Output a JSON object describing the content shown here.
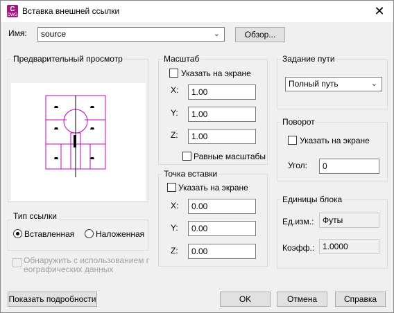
{
  "window": {
    "title": "Вставка внешней ссылки",
    "app_icon_letter": "C",
    "app_icon_sub": "DWG",
    "close_glyph": "✕"
  },
  "name_row": {
    "label": "Имя:",
    "value": "source",
    "browse_label": "Обзор..."
  },
  "preview": {
    "title": "Предварительный просмотр"
  },
  "scale": {
    "title": "Масштаб",
    "specify_on_screen": "Указать на экране",
    "x_label": "X:",
    "x_value": "1.00",
    "y_label": "Y:",
    "y_value": "1.00",
    "z_label": "Z:",
    "z_value": "1.00",
    "uniform_label": "Равные масштабы"
  },
  "path_type": {
    "title": "Задание пути",
    "value": "Полный путь"
  },
  "rotation": {
    "title": "Поворот",
    "specify_on_screen": "Указать на экране",
    "angle_label": "Угол:",
    "angle_value": "0"
  },
  "insertion": {
    "title": "Точка вставки",
    "specify_on_screen": "Указать на экране",
    "x_label": "X:",
    "x_value": "0.00",
    "y_label": "Y:",
    "y_value": "0.00",
    "z_label": "Z:",
    "z_value": "0.00"
  },
  "block_units": {
    "title": "Единицы блока",
    "unit_label": "Ед.изм.:",
    "unit_value": "Футы",
    "factor_label": "Коэфф.:",
    "factor_value": "1.0000"
  },
  "reference_type": {
    "title": "Тип ссылки",
    "attach_label": "Вставленная",
    "overlay_label": "Наложенная"
  },
  "geo": {
    "line1": "Обнаружить с использованием г",
    "line2": "еографических данных"
  },
  "buttons": {
    "details": "Показать подробности",
    "ok": "OK",
    "cancel": "Отмена",
    "help": "Справка"
  },
  "colors": {
    "preview_stroke": "#c000c0",
    "app_icon": "#a3187e"
  }
}
